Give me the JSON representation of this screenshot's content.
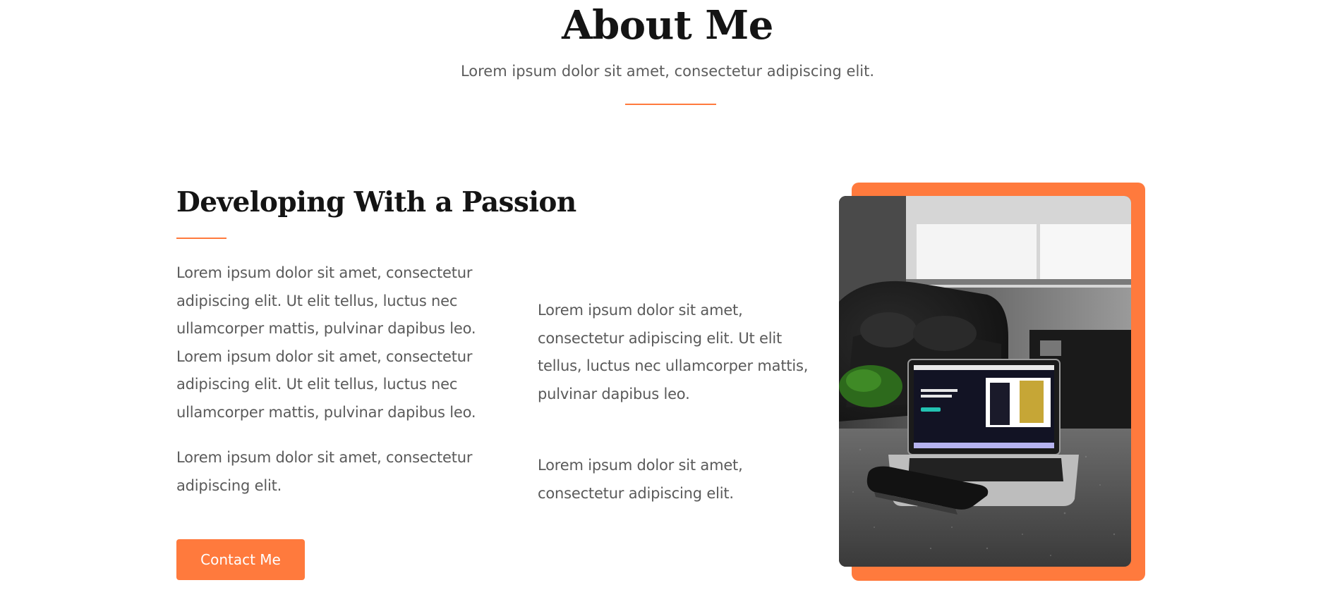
{
  "about": {
    "title": "About Me",
    "subtitle": "Lorem ipsum dolor sit amet, consectetur adipiscing elit."
  },
  "content": {
    "heading": "Developing With a Passion",
    "left_paragraph_1": "Lorem ipsum dolor sit amet, consectetur adipiscing elit. Ut elit tellus, luctus nec ullamcorper mattis, pulvinar dapibus leo. Lorem ipsum dolor sit amet, consectetur adipiscing elit. Ut elit tellus, luctus nec ullamcorper mattis, pulvinar dapibus leo.",
    "left_paragraph_2": "Lorem ipsum dolor sit amet, consectetur adipiscing elit.",
    "right_paragraph_1": "Lorem ipsum dolor sit amet, consectetur adipiscing elit. Ut elit tellus, luctus nec ullamcorper mattis, pulvinar dapibus leo.",
    "right_paragraph_2": "Lorem ipsum dolor sit amet, consectetur adipiscing elit.",
    "contact_button_label": "Contact Me"
  },
  "photo": {
    "subject": "laptop-on-desk-photo",
    "frame_color": "#ff7a3d"
  },
  "colors": {
    "accent": "#ff7a3d",
    "heading_text": "#141414",
    "body_text": "#5a5a5a",
    "background": "#ffffff"
  }
}
